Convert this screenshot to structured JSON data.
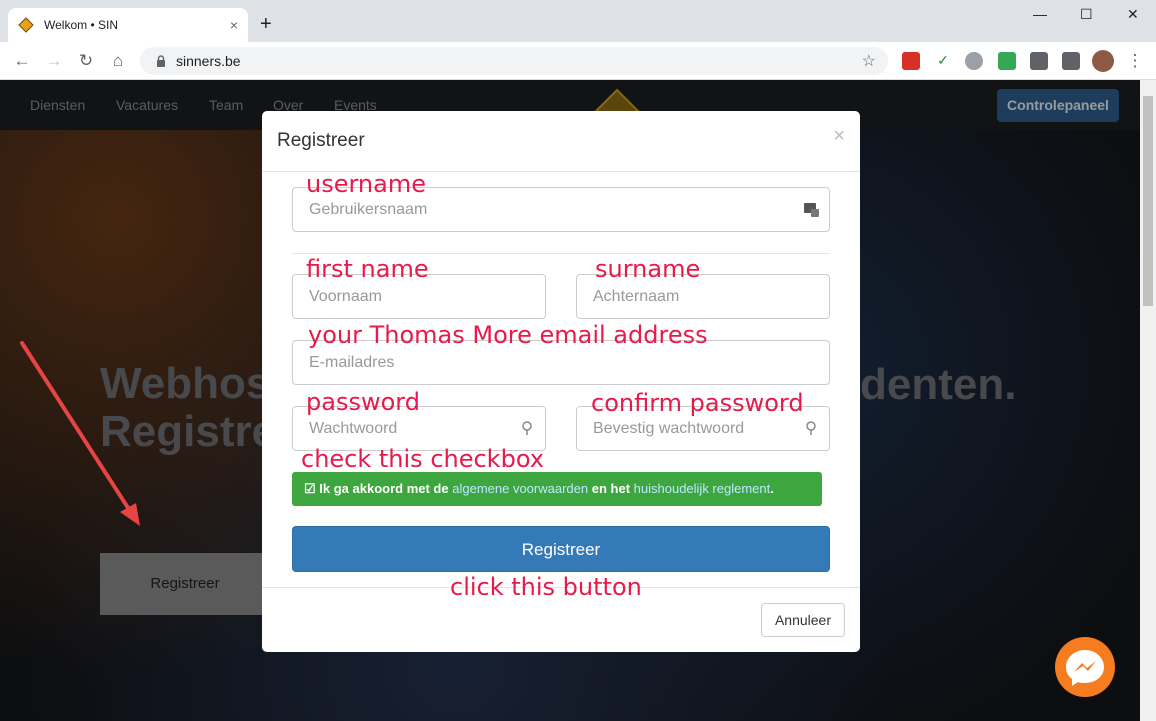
{
  "browser": {
    "tab_title": "Welkom • SIN",
    "tab_close": "×",
    "new_tab": "+",
    "url": "sinners.be",
    "window": {
      "minimize": "—",
      "maximize": "☐",
      "close": "✕"
    }
  },
  "site": {
    "nav": [
      "Diensten",
      "Vacatures",
      "Team",
      "Over",
      "Events"
    ],
    "control_panel": "Controlepaneel",
    "hero_title_line1": "Webhos",
    "hero_title_line2": "Registre",
    "hero_title_right": "denten.",
    "hero_button": "Registreer"
  },
  "modal": {
    "title": "Registreer",
    "close": "×",
    "username_placeholder": "Gebruikersnaam",
    "firstname_placeholder": "Voornaam",
    "lastname_placeholder": "Achternaam",
    "email_placeholder": "E-mailadres",
    "password_placeholder": "Wachtwoord",
    "confirm_placeholder": "Bevestig wachtwoord",
    "terms_prefix": "Ik ga akkoord met de",
    "terms_link1": "algemene voorwaarden",
    "terms_mid": "en het",
    "terms_link2": "huishoudelijk reglement",
    "terms_suffix": ".",
    "submit": "Registreer",
    "cancel": "Annuleer"
  },
  "annotations": {
    "username": "username",
    "first_name": "first name",
    "surname": "surname",
    "email": "your Thomas More email address",
    "password": "password",
    "confirm": "confirm password",
    "checkbox": "check this checkbox",
    "button": "click this button"
  },
  "colors": {
    "annotation": "#e8194b",
    "primary": "#337ab7",
    "success": "#3ea63e",
    "messenger": "#f57c1f"
  }
}
